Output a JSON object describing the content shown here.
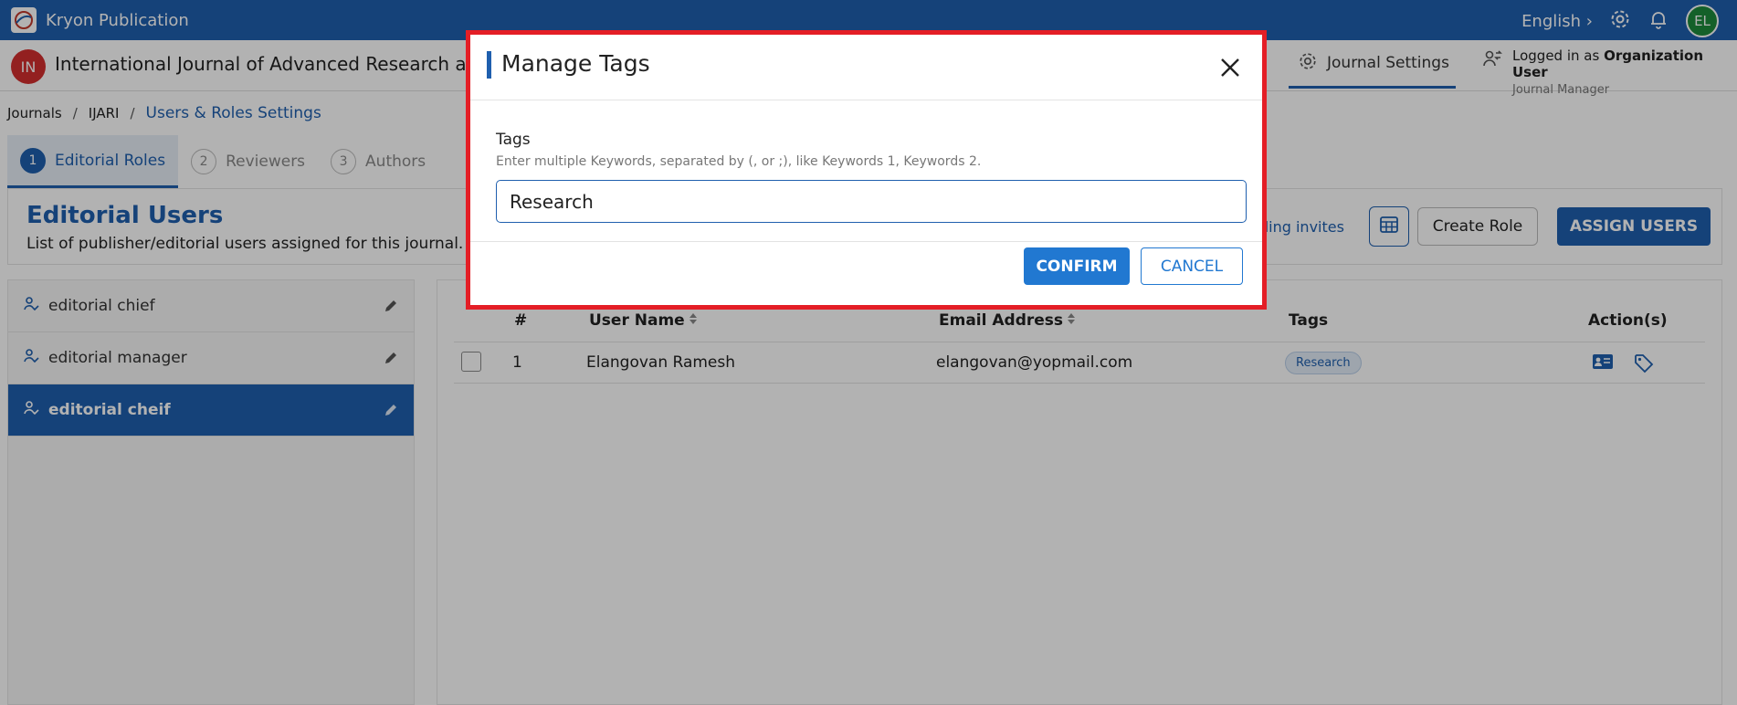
{
  "topbar": {
    "brand": "Kryon Publication",
    "language": "English",
    "avatar_initials": "EL"
  },
  "journal": {
    "badge": "IN",
    "title": "International Journal of Advanced Research ar",
    "settings_label": "Journal Settings",
    "logged_in_prefix": "Logged in as",
    "logged_in_user": "Organization User",
    "logged_in_role": "Journal Manager"
  },
  "breadcrumb": {
    "items": [
      "Journals",
      "IJARI"
    ],
    "separator": "/",
    "current": "Users & Roles Settings"
  },
  "tabs": [
    {
      "num": "1",
      "label": "Editorial Roles"
    },
    {
      "num": "2",
      "label": "Reviewers"
    },
    {
      "num": "3",
      "label": "Authors"
    }
  ],
  "section": {
    "title": "Editorial Users",
    "subtitle": "List of publisher/editorial users assigned for this journal.",
    "invites_link": "ding invites",
    "create_role": "Create Role",
    "assign_users": "ASSIGN USERS"
  },
  "roles": [
    {
      "label": "editorial chief"
    },
    {
      "label": "editorial manager"
    },
    {
      "label": "editorial cheif"
    }
  ],
  "table": {
    "headers": {
      "num": "#",
      "user": "User Name",
      "email": "Email Address",
      "tags": "Tags",
      "actions": "Action(s)"
    },
    "rows": [
      {
        "num": "1",
        "user": "Elangovan Ramesh",
        "email": "elangovan@yopmail.com",
        "tag": "Research"
      }
    ]
  },
  "modal": {
    "title": "Manage Tags",
    "field_label": "Tags",
    "field_hint": "Enter multiple Keywords, separated by (, or ;), like Keywords 1, Keywords 2.",
    "field_value": "Research",
    "confirm": "CONFIRM",
    "cancel": "CANCEL"
  },
  "colors": {
    "primary": "#1f5fae",
    "highlight_border": "#e41e26",
    "confirm_button": "#2178d1"
  }
}
